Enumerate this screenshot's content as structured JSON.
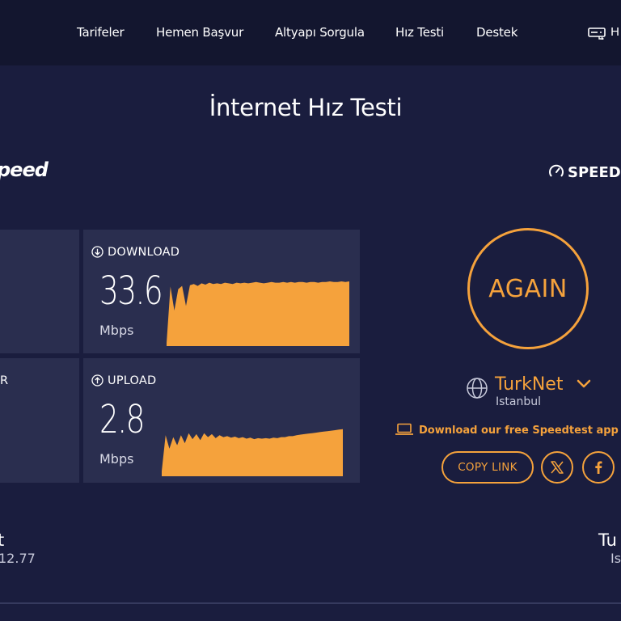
{
  "nav": {
    "items": [
      "Tarifeler",
      "Hemen Başvur",
      "Altyapı Sorgula",
      "Hız Testi",
      "Destek"
    ],
    "extra_label": "H"
  },
  "page": {
    "title": "İnternet Hız Testi"
  },
  "brand": {
    "left_logo_text": "peed",
    "right_logo_text": "SPEED"
  },
  "results": {
    "download": {
      "label": "DOWNLOAD",
      "value": "33.6",
      "unit": "Mbps",
      "samples": [
        0.05,
        0.92,
        0.55,
        0.88,
        0.93,
        0.62,
        0.94,
        0.96,
        0.93,
        0.97,
        0.95,
        0.98,
        0.96,
        0.97,
        0.96,
        0.98,
        0.97,
        0.96,
        0.98,
        0.97,
        0.98,
        0.97,
        0.98,
        0.99,
        0.98,
        0.97,
        0.98,
        0.99,
        0.98,
        0.98,
        0.99,
        0.98,
        0.99,
        0.98,
        0.99,
        0.99,
        0.98,
        0.99,
        0.99,
        0.98,
        0.99,
        0.99,
        1.0,
        0.99,
        0.99,
        1.0,
        0.99,
        1.0
      ]
    },
    "upload": {
      "label": "UPLOAD",
      "value": "2.8",
      "unit": "Mbps",
      "samples": [
        0.1,
        0.82,
        0.55,
        0.78,
        0.62,
        0.82,
        0.66,
        0.86,
        0.74,
        0.84,
        0.72,
        0.86,
        0.78,
        0.84,
        0.76,
        0.82,
        0.78,
        0.8,
        0.77,
        0.79,
        0.76,
        0.78,
        0.75,
        0.77,
        0.74,
        0.76,
        0.75,
        0.76,
        0.75,
        0.77,
        0.76,
        0.78,
        0.78,
        0.8,
        0.8,
        0.82,
        0.83,
        0.84,
        0.85,
        0.86,
        0.87,
        0.88,
        0.89,
        0.9,
        0.91,
        0.92,
        0.93,
        0.94
      ]
    },
    "left_partial_label": "R"
  },
  "actions": {
    "again_label": "AGAIN",
    "copy_link_label": "COPY LINK"
  },
  "isp": {
    "name": "TurkNet",
    "city": "Istanbul"
  },
  "promo": {
    "text": "Download our free Speedtest app for d"
  },
  "bottom": {
    "left_name": "t",
    "left_sub": "12.77",
    "right_name": "Tu",
    "right_sub": "Is"
  },
  "colors": {
    "accent": "#f5a23c",
    "background": "#1a1d3e",
    "panel": "#2a2e4f",
    "topbar": "#13162f"
  }
}
